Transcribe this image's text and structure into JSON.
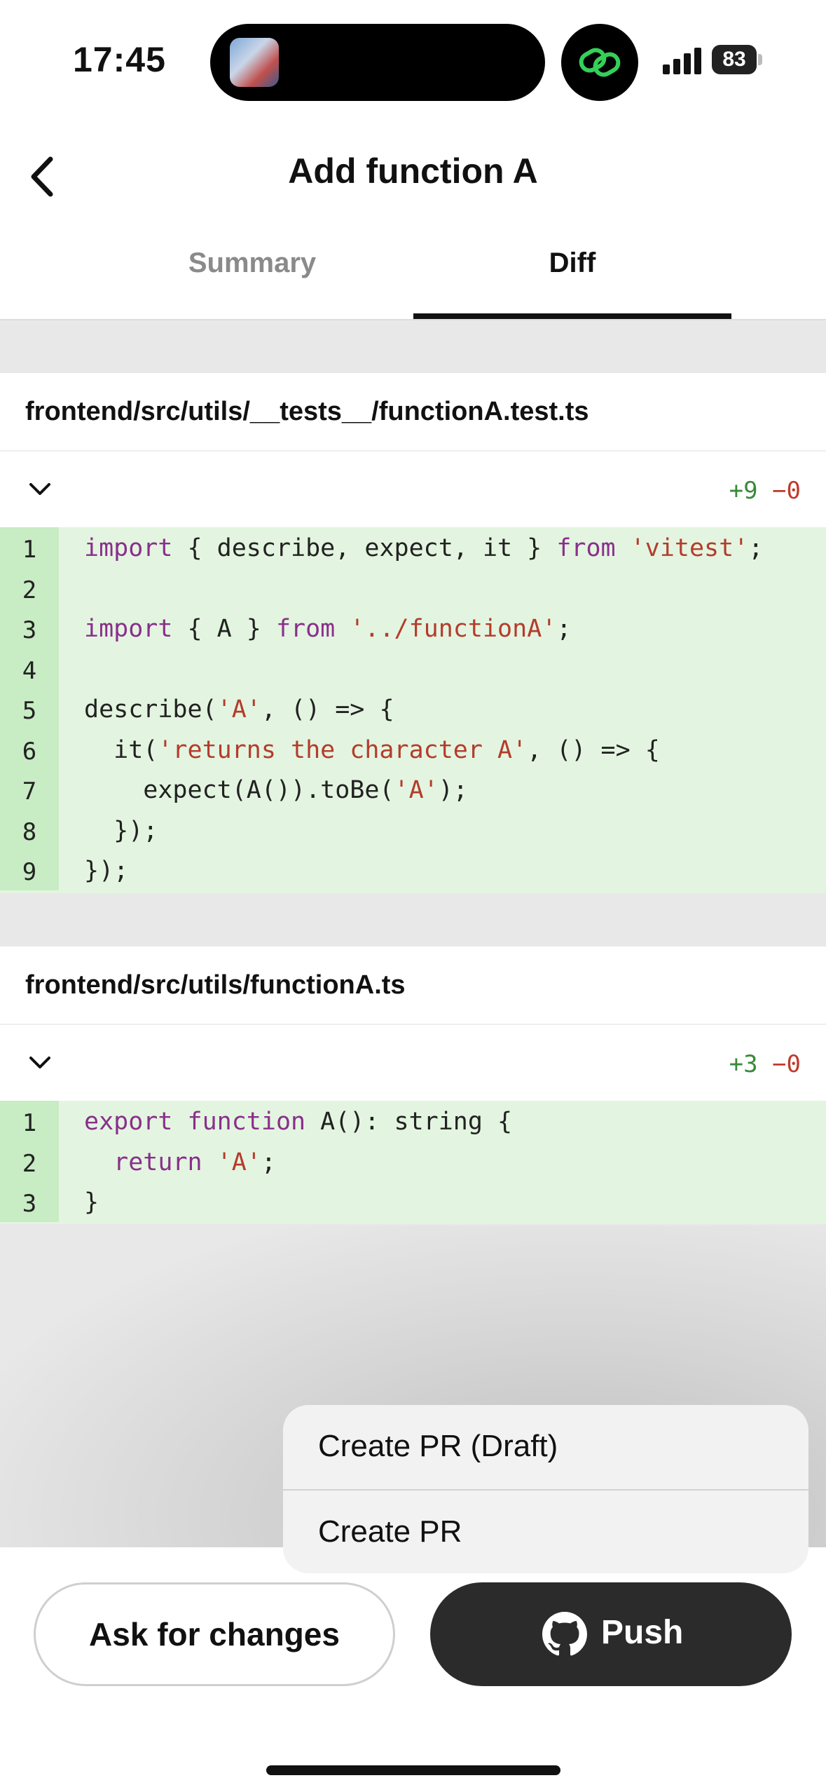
{
  "status_bar": {
    "time": "17:45",
    "battery": "83"
  },
  "header": {
    "title": "Add function A",
    "tabs": [
      {
        "label": "Summary"
      },
      {
        "label": "Diff"
      }
    ]
  },
  "files": [
    {
      "path": "frontend/src/utils/__tests__/functionA.test.ts",
      "additions": "+9",
      "deletions": "−0",
      "lines": [
        {
          "n": "1",
          "tokens": [
            {
              "t": "import",
              "c": "kw"
            },
            {
              "t": " { describe, expect, it } ",
              "c": ""
            },
            {
              "t": "from",
              "c": "kw"
            },
            {
              "t": " ",
              "c": ""
            },
            {
              "t": "'vitest'",
              "c": "str"
            },
            {
              "t": ";",
              "c": ""
            }
          ]
        },
        {
          "n": "2",
          "tokens": []
        },
        {
          "n": "3",
          "tokens": [
            {
              "t": "import",
              "c": "kw"
            },
            {
              "t": " { A } ",
              "c": ""
            },
            {
              "t": "from",
              "c": "kw"
            },
            {
              "t": " ",
              "c": ""
            },
            {
              "t": "'../functionA'",
              "c": "str"
            },
            {
              "t": ";",
              "c": ""
            }
          ]
        },
        {
          "n": "4",
          "tokens": []
        },
        {
          "n": "5",
          "tokens": [
            {
              "t": "describe(",
              "c": ""
            },
            {
              "t": "'A'",
              "c": "str"
            },
            {
              "t": ", () => {",
              "c": ""
            }
          ]
        },
        {
          "n": "6",
          "tokens": [
            {
              "t": "  it(",
              "c": ""
            },
            {
              "t": "'returns the character A'",
              "c": "str"
            },
            {
              "t": ", () => {",
              "c": ""
            }
          ]
        },
        {
          "n": "7",
          "tokens": [
            {
              "t": "    expect(A()).toBe(",
              "c": ""
            },
            {
              "t": "'A'",
              "c": "str"
            },
            {
              "t": ");",
              "c": ""
            }
          ]
        },
        {
          "n": "8",
          "tokens": [
            {
              "t": "  });",
              "c": ""
            }
          ]
        },
        {
          "n": "9",
          "tokens": [
            {
              "t": "});",
              "c": ""
            }
          ]
        }
      ]
    },
    {
      "path": "frontend/src/utils/functionA.ts",
      "additions": "+3",
      "deletions": "−0",
      "lines": [
        {
          "n": "1",
          "tokens": [
            {
              "t": "export",
              "c": "kw"
            },
            {
              "t": " ",
              "c": ""
            },
            {
              "t": "function",
              "c": "kw"
            },
            {
              "t": " A(): string {",
              "c": ""
            }
          ]
        },
        {
          "n": "2",
          "tokens": [
            {
              "t": "  ",
              "c": ""
            },
            {
              "t": "return",
              "c": "kw"
            },
            {
              "t": " ",
              "c": ""
            },
            {
              "t": "'A'",
              "c": "str"
            },
            {
              "t": ";",
              "c": ""
            }
          ]
        },
        {
          "n": "3",
          "tokens": [
            {
              "t": "}",
              "c": ""
            }
          ]
        }
      ]
    }
  ],
  "menu": {
    "items": [
      {
        "label": "Create PR (Draft)"
      },
      {
        "label": "Create PR"
      }
    ]
  },
  "actions": {
    "ask_label": "Ask for changes",
    "push_label": "Push"
  },
  "icons": {
    "back": "chevron-left-icon",
    "collapse": "chevron-down-icon",
    "github": "github-icon",
    "app": "linked-rings-icon"
  },
  "colors": {
    "added_bg": "#e3f5e0",
    "gutter_bg": "#c8ecc4",
    "keyword": "#8a2f8c",
    "string": "#b43c2c",
    "additions": "#3a8a3a",
    "deletions": "#c0392b"
  }
}
